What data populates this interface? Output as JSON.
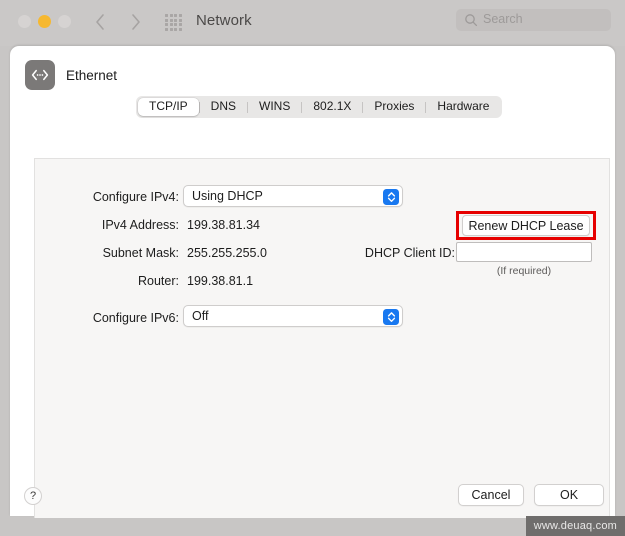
{
  "window": {
    "title": "Network",
    "traffic_lights": [
      "close",
      "minimize",
      "zoom"
    ],
    "nav": {
      "back": "back-chevron",
      "forward": "forward-chevron",
      "show_all": "grid-icon"
    },
    "search": {
      "placeholder": "Search",
      "value": "",
      "icon": "search-icon"
    }
  },
  "sheet": {
    "service": {
      "name": "Ethernet",
      "icon": "ethernet-icon"
    },
    "tabs": [
      {
        "label": "TCP/IP",
        "selected": true
      },
      {
        "label": "DNS",
        "selected": false
      },
      {
        "label": "WINS",
        "selected": false
      },
      {
        "label": "802.1X",
        "selected": false
      },
      {
        "label": "Proxies",
        "selected": false
      },
      {
        "label": "Hardware",
        "selected": false
      }
    ],
    "form": {
      "configure_ipv4": {
        "label": "Configure IPv4:",
        "value": "Using DHCP"
      },
      "ipv4_address": {
        "label": "IPv4 Address:",
        "value": "199.38.81.34"
      },
      "subnet_mask": {
        "label": "Subnet Mask:",
        "value": "255.255.255.0"
      },
      "router": {
        "label": "Router:",
        "value": "199.38.81.1"
      },
      "configure_ipv6": {
        "label": "Configure IPv6:",
        "value": "Off"
      },
      "renew_button": "Renew DHCP Lease",
      "dhcp_client_id": {
        "label": "DHCP Client ID:",
        "value": "",
        "hint": "(If required)"
      }
    },
    "footer": {
      "help": "?",
      "cancel": "Cancel",
      "ok": "OK"
    }
  },
  "annotation": {
    "color": "#e60000",
    "target": "renew-dhcp-lease-button"
  },
  "watermark": "www.deuaq.com"
}
